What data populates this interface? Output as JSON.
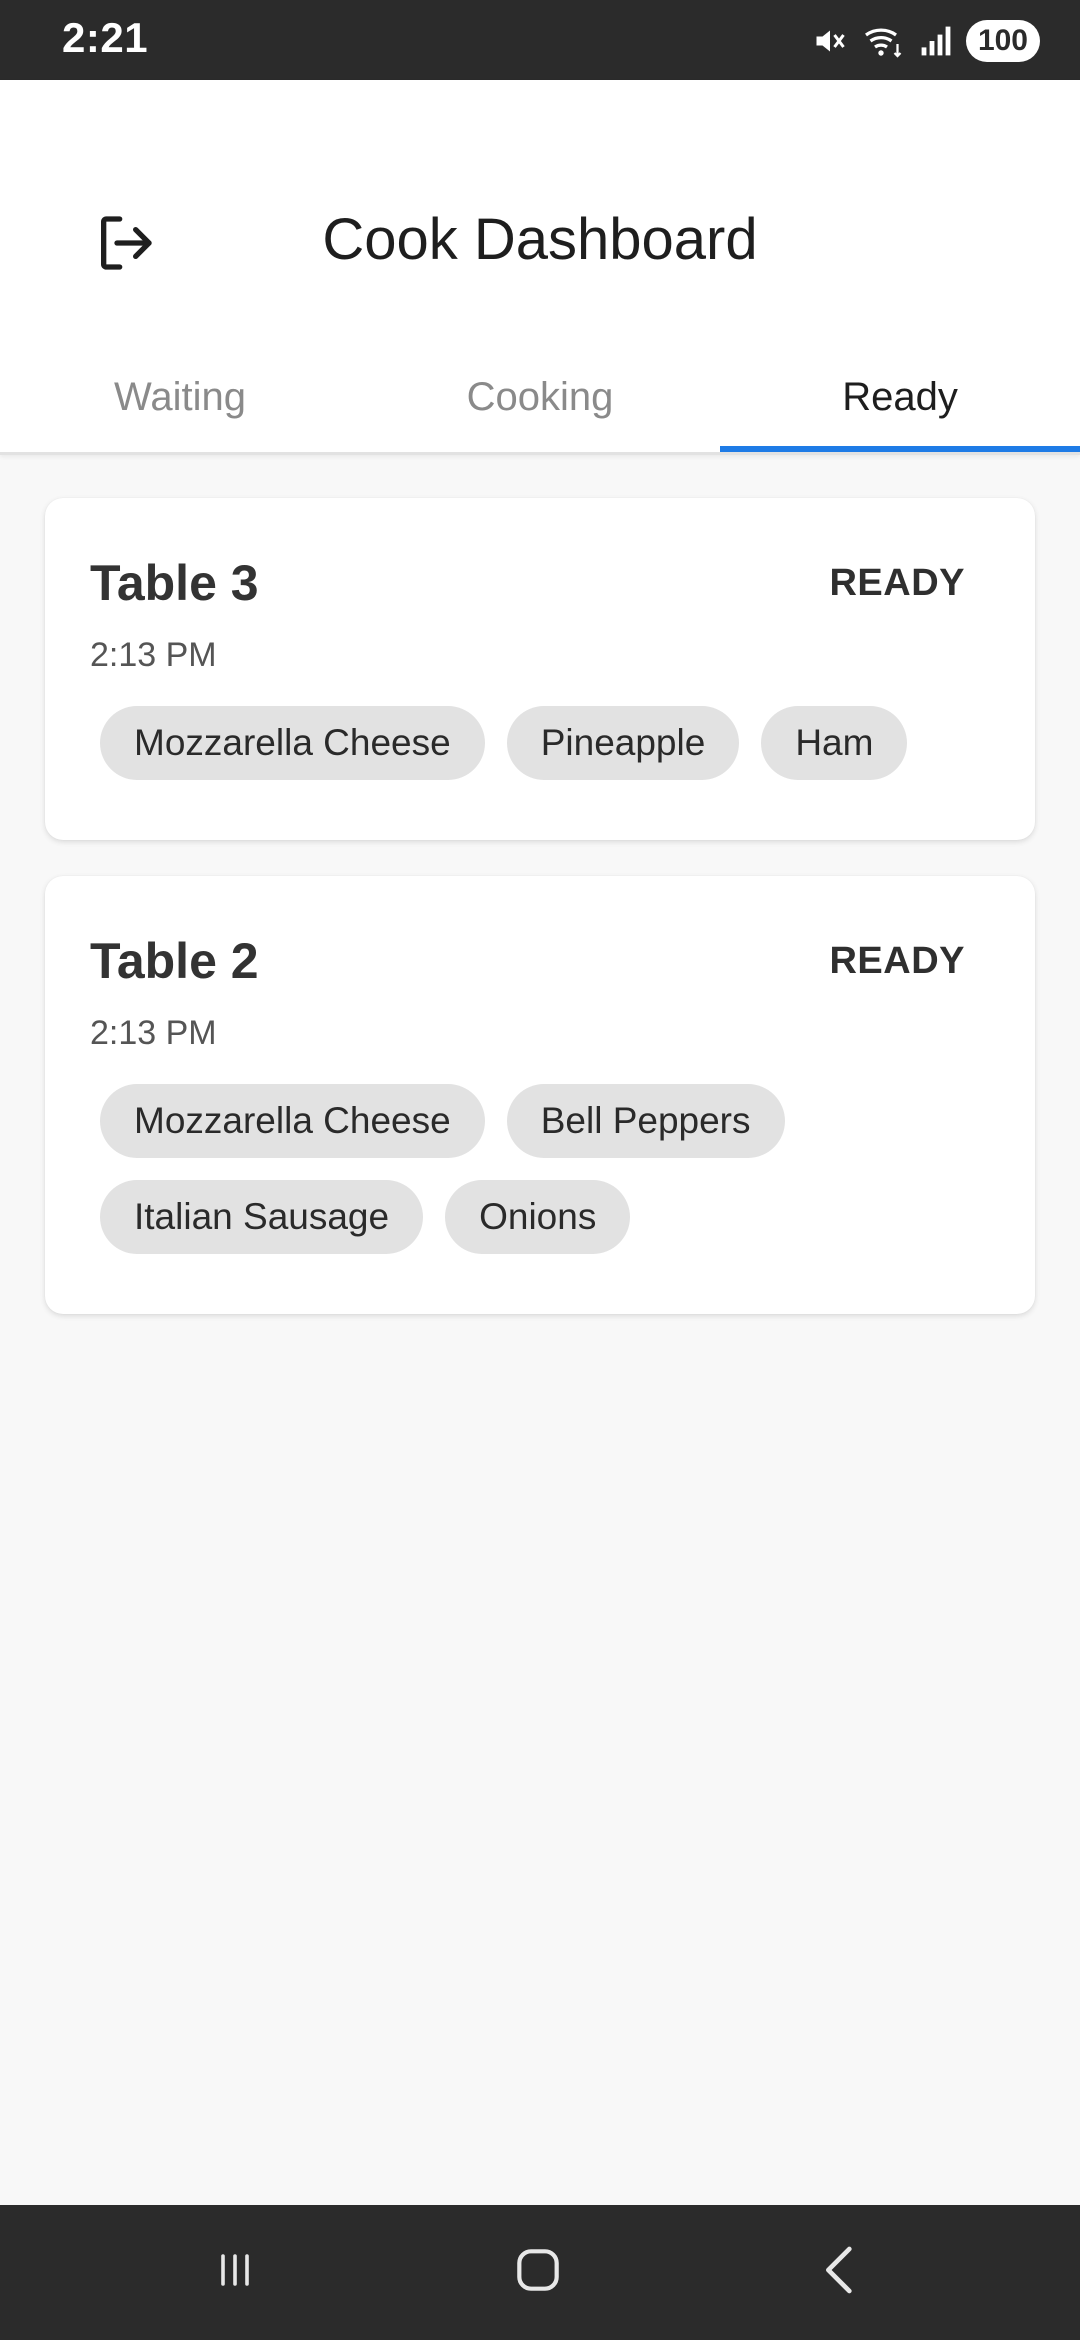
{
  "status_bar": {
    "time": "2:21",
    "battery": "100",
    "icons": [
      "mute-icon",
      "wifi-icon",
      "signal-icon"
    ]
  },
  "header": {
    "title": "Cook Dashboard",
    "logout_icon": "logout-icon"
  },
  "tabs": [
    {
      "label": "Waiting",
      "active": false
    },
    {
      "label": "Cooking",
      "active": false
    },
    {
      "label": "Ready",
      "active": true
    }
  ],
  "orders": [
    {
      "table": "Table 3",
      "status": "READY",
      "time": "2:13 PM",
      "ingredients": [
        "Mozzarella Cheese",
        "Pineapple",
        "Ham"
      ]
    },
    {
      "table": "Table 2",
      "status": "READY",
      "time": "2:13 PM",
      "ingredients": [
        "Mozzarella Cheese",
        "Bell Peppers",
        "Italian Sausage",
        "Onions"
      ]
    }
  ],
  "nav_bar": {
    "icons": [
      "recent-apps-icon",
      "home-icon",
      "back-icon"
    ]
  },
  "colors": {
    "accent": "#1e7be6",
    "chip_bg": "#e2e2e2",
    "system_bar": "#2b2b2b",
    "background": "#f8f8f8"
  }
}
